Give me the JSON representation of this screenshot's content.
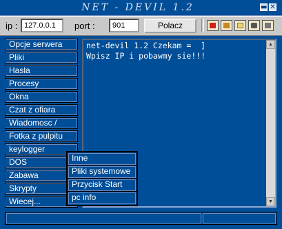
{
  "window": {
    "title": "NET - DEVIL 1.2"
  },
  "titlebar_buttons": {
    "minimize_glyph": "▬",
    "close_glyph": "✕"
  },
  "connection": {
    "ip_label": "ip :",
    "ip_value": "127.0.0.1",
    "port_label": "port :",
    "port_value": "901",
    "connect_label": "Polacz"
  },
  "toolbar_icons": [
    "red-card-icon",
    "photo-icon",
    "folder-icon",
    "camera-icon",
    "disk-icon"
  ],
  "menu": {
    "items": [
      {
        "label": "Opcje serwera"
      },
      {
        "label": "Pliki"
      },
      {
        "label": "Hasla"
      },
      {
        "label": "Procesy"
      },
      {
        "label": "Okna"
      },
      {
        "label": "Czat z ofiara"
      },
      {
        "label": "Wiadomosc /"
      },
      {
        "label": "Fotka z pulpitu"
      },
      {
        "label": "keylogger"
      },
      {
        "label": "DOS"
      },
      {
        "label": "Zabawa"
      },
      {
        "label": "Skrypty"
      },
      {
        "label": "Wiecej..."
      }
    ]
  },
  "popup": {
    "items": [
      {
        "label": "Inne"
      },
      {
        "label": "Pliki systemowe"
      },
      {
        "label": "Przycisk Start"
      },
      {
        "label": "pc info"
      }
    ]
  },
  "console": {
    "lines": [
      "net-devil 1.2 Czekam =  ]",
      "Wpisz IP i pobawmy sie!!!"
    ]
  },
  "status": {
    "left": "",
    "right": ""
  },
  "colors": {
    "background": "#004e98",
    "toolbar": "#c9c9c9",
    "text": "#ffffff"
  }
}
